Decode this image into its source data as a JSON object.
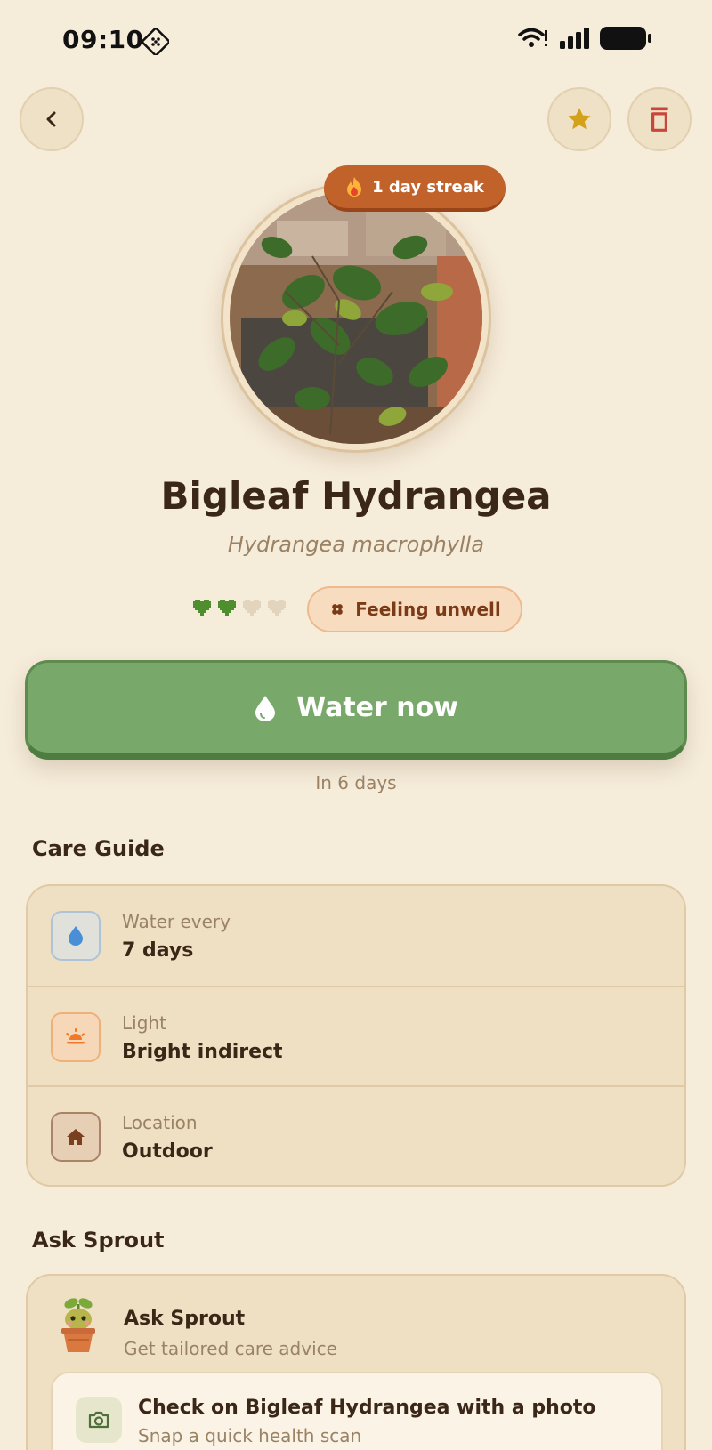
{
  "status_bar": {
    "time": "09:10"
  },
  "header": {
    "back_icon": "chevron-left-icon",
    "favorite_icon": "star-icon",
    "delete_icon": "trash-icon"
  },
  "plant": {
    "streak": "1 day streak",
    "streak_icon": "fire-icon",
    "name": "Bigleaf Hydrangea",
    "scientific_name": "Hydrangea macrophylla",
    "health_hearts_filled": 2,
    "health_hearts_total": 4,
    "status": "Feeling unwell",
    "status_icon": "bandage-icon"
  },
  "water": {
    "button_label": "Water now",
    "button_icon": "water-drop-icon",
    "next_text": "In 6 days"
  },
  "care_guide": {
    "title": "Care Guide",
    "items": [
      {
        "label": "Water every",
        "value": "7 days",
        "icon": "water-drop-icon"
      },
      {
        "label": "Light",
        "value": "Bright indirect",
        "icon": "sunrise-icon"
      },
      {
        "label": "Location",
        "value": "Outdoor",
        "icon": "home-icon"
      }
    ]
  },
  "ask_sprout": {
    "section_title": "Ask Sprout",
    "card_title": "Ask Sprout",
    "card_subtitle": "Get tailored care advice",
    "check_title": "Check on Bigleaf Hydrangea with a photo",
    "check_subtitle": "Snap a quick health scan",
    "check_icon": "camera-icon"
  },
  "colors": {
    "background": "#f6ecda",
    "accent_green": "#79a96a",
    "streak_orange": "#c1622a",
    "heart_green": "#4e8e2e",
    "star_gold": "#d4a11a",
    "trash_red": "#c8463a"
  }
}
